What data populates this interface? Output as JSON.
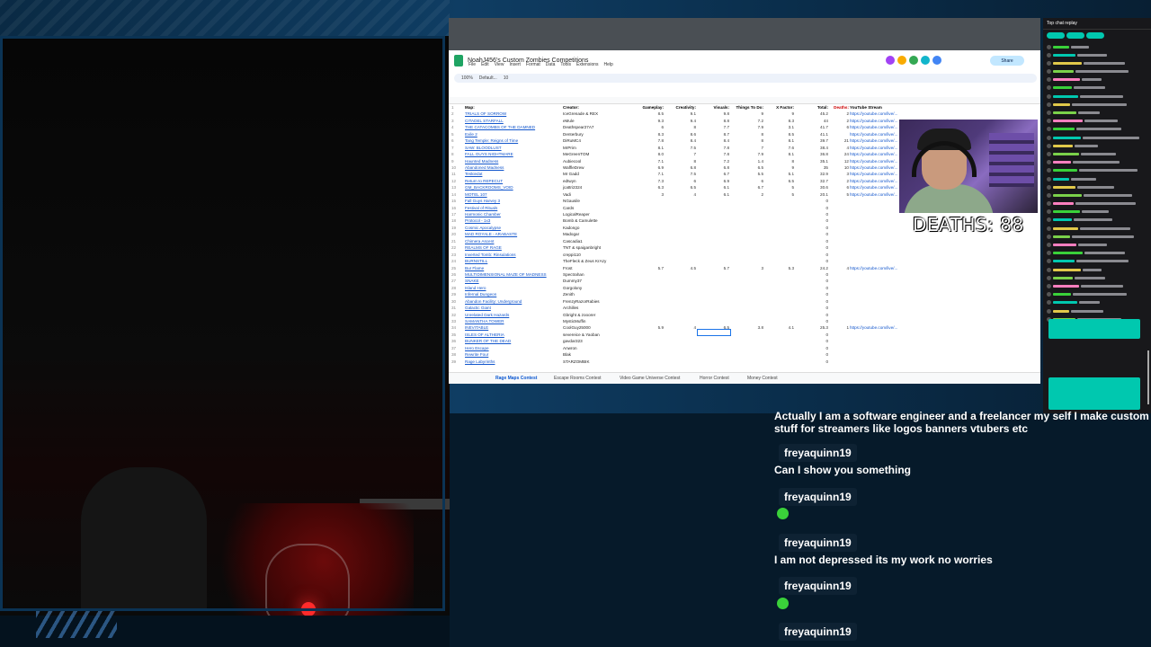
{
  "overlay": {
    "deaths_label": "DEATHS: 88"
  },
  "sheet": {
    "title": "NoahJ456's Custom Zombies Competitions",
    "menus": [
      "File",
      "Edit",
      "View",
      "Insert",
      "Format",
      "Data",
      "Tools",
      "Extensions",
      "Help"
    ],
    "share_label": "Share",
    "zoom": "100%",
    "font": "Default...",
    "font_size": "10",
    "headers": {
      "map": "Map:",
      "creator": "Creator:",
      "gameplay": "Gameplay:",
      "creativity": "Creativity:",
      "visuals": "Visuals:",
      "things_to_do": "Things To Do:",
      "x_factor": "X Factor:",
      "total": "Total:",
      "deaths": "Deaths:",
      "youtube": "YouTube Stream"
    },
    "rows": [
      {
        "n": "2",
        "map": "TRIALS OF SORROW",
        "creator": "IceGrenade & REX",
        "g": "8.5",
        "c": "9.1",
        "v": "9.8",
        "t": "9",
        "x": "9",
        "tot": "45.2",
        "d": "2",
        "yt": "https://youtube.com/live/..."
      },
      {
        "n": "3",
        "map": "CITADEL STARFALL",
        "creator": "eMule",
        "g": "9.3",
        "c": "9.4",
        "v": "8.8",
        "t": "7.2",
        "x": "8.3",
        "tot": "44",
        "d": "2",
        "yt": "https://youtube.com/live/..."
      },
      {
        "n": "4",
        "map": "THE CATACOMBS OF THE DAMNED",
        "creator": "Deathspear27A7",
        "g": "6",
        "c": "8",
        "v": "7.7",
        "t": "7.9",
        "x": "3.1",
        "tot": "41.7",
        "d": "6",
        "yt": "https://youtube.com/live/..."
      },
      {
        "n": "5",
        "map": "Exile 2",
        "creator": "Denterbury",
        "g": "8.3",
        "c": "8.6",
        "v": "8.7",
        "t": "8",
        "x": "8.5",
        "tot": "41.1",
        "d": "",
        "yt": "https://youtube.com/live/..."
      },
      {
        "n": "6",
        "map": "Tang Temple: Reigns of Time",
        "creator": "DiRuMC4",
        "g": "7.8",
        "c": "8.4",
        "v": "8.4",
        "t": "8",
        "x": "8.1",
        "tot": "39.7",
        "d": "21",
        "yt": "https://youtube.com/live/..."
      },
      {
        "n": "7",
        "map": "SAW: BLOODLUST",
        "creator": "MrPrim",
        "g": "8.1",
        "c": "7.5",
        "v": "7.8",
        "t": "7",
        "x": "7.6",
        "tot": "38.4",
        "d": "4",
        "yt": "https://youtube.com/live/..."
      },
      {
        "n": "8",
        "map": "FALL GUYS NIGHTMARE",
        "creator": "MeGreenTOM",
        "g": "8.0",
        "c": "7",
        "v": "7.8",
        "t": "7.9",
        "x": "8.1",
        "tot": "36.8",
        "d": "24",
        "yt": "https://youtube.com/live/..."
      },
      {
        "n": "9",
        "map": "Haunted Madness",
        "creator": "Aubiecool",
        "g": "7.1",
        "c": "8",
        "v": "7.2",
        "t": "1.4",
        "x": "8",
        "tot": "35.1",
        "d": "12",
        "yt": "https://youtube.com/live/..."
      },
      {
        "n": "10",
        "map": "Abandoned Madness",
        "creator": "WaffleDrew",
        "g": "6.9",
        "c": "6.8",
        "v": "6.8",
        "t": "6.5",
        "x": "9",
        "tot": "35",
        "d": "10",
        "yt": "https://youtube.com/live/..."
      },
      {
        "n": "11",
        "map": "Teskiedat",
        "creator": "Mr Gadd",
        "g": "7.1",
        "c": "7.5",
        "v": "6.7",
        "t": "5.5",
        "x": "5.1",
        "tot": "32.9",
        "d": "3",
        "yt": "https://youtube.com/live/..."
      },
      {
        "n": "12",
        "map": "Return to REPECUT",
        "creator": "edtwyn",
        "g": "7.3",
        "c": "6",
        "v": "6.9",
        "t": "6",
        "x": "6.5",
        "tot": "32.7",
        "d": "2",
        "yt": "https://youtube.com/live/..."
      },
      {
        "n": "13",
        "map": "GM_BACKROOMS_VOID",
        "creator": "jcattri2324",
        "g": "6.3",
        "c": "6.5",
        "v": "6.1",
        "t": "6.7",
        "x": "5",
        "tot": "30.6",
        "d": "6",
        "yt": "https://youtube.com/live/..."
      },
      {
        "n": "14",
        "map": "MOTEL 107",
        "creator": "Vadi",
        "g": "3",
        "c": "4",
        "v": "6.1",
        "t": "2",
        "x": "5",
        "tot": "20.1",
        "d": "5",
        "yt": "https://youtube.com/live/..."
      },
      {
        "n": "15",
        "map": "Fall Guys Harvey 3",
        "creator": "NGausile",
        "g": "",
        "c": "",
        "v": "",
        "t": "",
        "x": "",
        "tot": "0",
        "d": "",
        "yt": ""
      },
      {
        "n": "16",
        "map": "Festival of Rituals",
        "creator": "Cards",
        "g": "",
        "c": "",
        "v": "",
        "t": "",
        "x": "",
        "tot": "0",
        "d": "",
        "yt": ""
      },
      {
        "n": "17",
        "map": "Harmonic Chamber",
        "creator": "LogicalReaper",
        "g": "",
        "c": "",
        "v": "",
        "t": "",
        "x": "",
        "tot": "0",
        "d": "",
        "yt": ""
      },
      {
        "n": "18",
        "map": "Protocol - 1x3",
        "creator": "Bomb & Camulette",
        "g": "",
        "c": "",
        "v": "",
        "t": "",
        "x": "",
        "tot": "0",
        "d": "",
        "yt": ""
      },
      {
        "n": "19",
        "map": "Cosmic Apocalypse",
        "creator": "Kadongo",
        "g": "",
        "c": "",
        "v": "",
        "t": "",
        "x": "",
        "tot": "0",
        "d": "",
        "yt": ""
      },
      {
        "n": "20",
        "map": "MAD ROYALE - ARABASTE",
        "creator": "Madogar",
        "g": "",
        "c": "",
        "v": "",
        "t": "",
        "x": "",
        "tot": "0",
        "d": "",
        "yt": ""
      },
      {
        "n": "21",
        "map": "Chimera Ascent",
        "creator": "Cascadia1",
        "g": "",
        "c": "",
        "v": "",
        "t": "",
        "x": "",
        "tot": "0",
        "d": "",
        "yt": ""
      },
      {
        "n": "22",
        "map": "REALMS OF RAGE",
        "creator": "TNT & spaiganbright",
        "g": "",
        "c": "",
        "v": "",
        "t": "",
        "x": "",
        "tot": "0",
        "d": "",
        "yt": ""
      },
      {
        "n": "23",
        "map": "Inverted Tomb: Rinsulations",
        "creator": "creppi110",
        "g": "",
        "c": "",
        "v": "",
        "t": "",
        "x": "",
        "tot": "0",
        "d": "",
        "yt": ""
      },
      {
        "n": "24",
        "map": "BURNSTILL",
        "creator": "TheFleck & Zeus KrAzy",
        "g": "",
        "c": "",
        "v": "",
        "t": "",
        "x": "",
        "tot": "0",
        "d": "",
        "yt": ""
      },
      {
        "n": "25",
        "map": "Bur Flame",
        "creator": "Frost",
        "g": "5.7",
        "c": "4.5",
        "v": "5.7",
        "t": "3",
        "x": "5.3",
        "tot": "24.2",
        "d": "4",
        "yt": "https://youtube.com/live/..."
      },
      {
        "n": "26",
        "map": "MULTIDIMENSIONAL MAZE OF MADNESS",
        "creator": "Spectrahan",
        "g": "",
        "c": "",
        "v": "",
        "t": "",
        "x": "",
        "tot": "0",
        "d": "",
        "yt": ""
      },
      {
        "n": "27",
        "map": "SNAKE",
        "creator": "Dummy37",
        "g": "",
        "c": "",
        "v": "",
        "t": "",
        "x": "",
        "tot": "0",
        "d": "",
        "yt": ""
      },
      {
        "n": "28",
        "map": "Island Hero",
        "creator": "Gorgolony",
        "g": "",
        "c": "",
        "v": "",
        "t": "",
        "x": "",
        "tot": "0",
        "d": "",
        "yt": ""
      },
      {
        "n": "29",
        "map": "Infernal Dungeon",
        "creator": "Zenith",
        "g": "",
        "c": "",
        "v": "",
        "t": "",
        "x": "",
        "tot": "0",
        "d": "",
        "yt": ""
      },
      {
        "n": "30",
        "map": "Abandon Facility: Underground",
        "creator": "FrenzyRazorRabies",
        "g": "",
        "c": "",
        "v": "",
        "t": "",
        "x": "",
        "tot": "0",
        "d": "",
        "yt": ""
      },
      {
        "n": "31",
        "map": "Galactic Giant",
        "creator": "Archilles",
        "g": "",
        "c": "",
        "v": "",
        "t": "",
        "x": "",
        "tot": "0",
        "d": "",
        "yt": ""
      },
      {
        "n": "32",
        "map": "Unrelated Dark Hazards",
        "creator": "Gbright & zooorer",
        "g": "",
        "c": "",
        "v": "",
        "t": "",
        "x": "",
        "tot": "0",
        "d": "",
        "yt": ""
      },
      {
        "n": "33",
        "map": "SAMANTHA TOWER",
        "creator": "MysticMuffin",
        "g": "",
        "c": "",
        "v": "",
        "t": "",
        "x": "",
        "tot": "0",
        "d": "",
        "yt": ""
      },
      {
        "n": "34",
        "map": "INEVITABLE",
        "creator": "CoolGuy25000",
        "g": "5.9",
        "c": "4",
        "v": "6.5",
        "t": "3.8",
        "x": "4.1",
        "tot": "25.3",
        "d": "1",
        "yt": "https://youtube.com/live/..."
      },
      {
        "n": "35",
        "map": "ISLES OF ALTHERIA",
        "creator": "severeice & Yaoban",
        "g": "",
        "c": "",
        "v": "",
        "t": "",
        "x": "",
        "tot": "0",
        "d": "",
        "yt": ""
      },
      {
        "n": "36",
        "map": "BUNKER OF THE DEAD",
        "creator": "gavdar323",
        "g": "",
        "c": "",
        "v": "",
        "t": "",
        "x": "",
        "tot": "0",
        "d": "",
        "yt": ""
      },
      {
        "n": "37",
        "map": "Hero Escape",
        "creator": "Anwron",
        "g": "",
        "c": "",
        "v": "",
        "t": "",
        "x": "",
        "tot": "0",
        "d": "",
        "yt": ""
      },
      {
        "n": "38",
        "map": "Rewrite Four",
        "creator": "Blak",
        "g": "",
        "c": "",
        "v": "",
        "t": "",
        "x": "",
        "tot": "0",
        "d": "",
        "yt": ""
      },
      {
        "n": "39",
        "map": "Rage Labyrinths",
        "creator": "STARZOMBIK",
        "g": "",
        "c": "",
        "v": "",
        "t": "",
        "x": "",
        "tot": "0",
        "d": "",
        "yt": ""
      }
    ],
    "tabs": [
      "Rage Maps Contest",
      "Escape Rooms Contest",
      "Video Game Universe Contest",
      "Horror Contest",
      "Money Contest"
    ]
  },
  "chat_right": {
    "header": "Top chat replay"
  },
  "chat": {
    "top_message": "Actually I am a software engineer and a freelancer my self I make custom stuff for streamers like logos banners vtubers etc",
    "entries": [
      {
        "user": "freyaquinn19",
        "text": "Can I show you something"
      },
      {
        "user": "freyaquinn19",
        "text": ""
      },
      {
        "user": "freyaquinn19",
        "text": "I am not depressed its my work no worries"
      },
      {
        "user": "freyaquinn19",
        "text": ""
      },
      {
        "user": "freyaquinn19",
        "text": ""
      }
    ]
  },
  "colors": {
    "accent_teal": "#00c8af",
    "sheet_link": "#1155cc",
    "deaths_red": "#cc0000"
  }
}
